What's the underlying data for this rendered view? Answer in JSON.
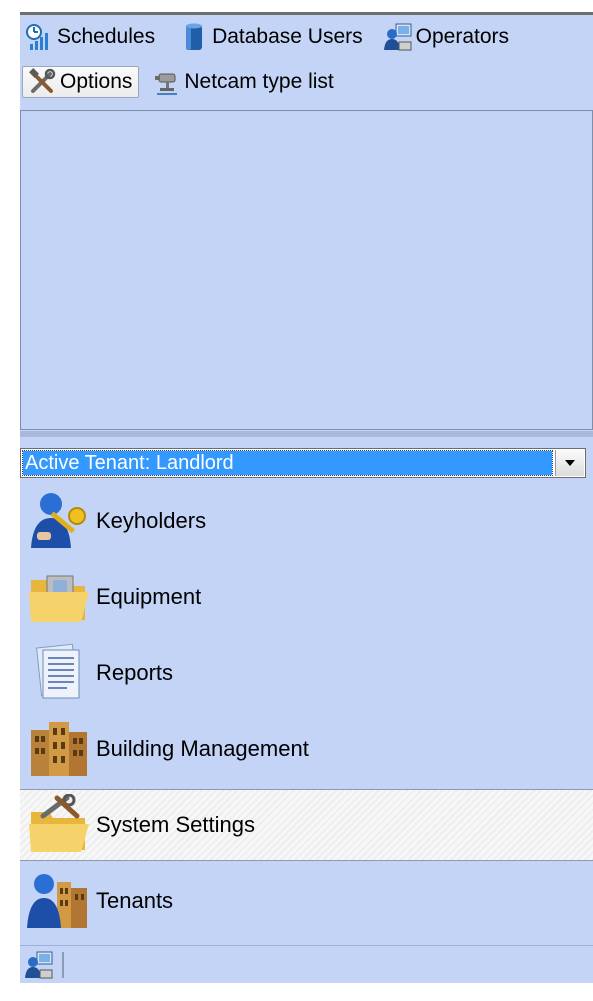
{
  "toolbar": {
    "row1": [
      {
        "label": "Schedules",
        "icon": "schedules-icon"
      },
      {
        "label": "Database Users",
        "icon": "database-users-icon"
      },
      {
        "label": "Operators",
        "icon": "operators-icon"
      }
    ],
    "row2": [
      {
        "label": "Options",
        "icon": "options-tools-icon",
        "active": true
      },
      {
        "label": "Netcam type list",
        "icon": "netcam-icon"
      }
    ]
  },
  "tenant_selector": {
    "value": "Active Tenant: Landlord"
  },
  "nav": [
    {
      "label": "Keyholders",
      "icon": "keyholders-icon"
    },
    {
      "label": "Equipment",
      "icon": "equipment-folder-icon"
    },
    {
      "label": "Reports",
      "icon": "reports-icon"
    },
    {
      "label": "Building Management",
      "icon": "building-icon"
    },
    {
      "label": "System Settings",
      "icon": "system-settings-icon",
      "selected": true
    },
    {
      "label": "Tenants",
      "icon": "tenants-icon"
    }
  ],
  "colors": {
    "panel_bg": "#c4d4f6",
    "selection_blue": "#3399ff",
    "selected_item_bg": "#f2f2f2"
  }
}
